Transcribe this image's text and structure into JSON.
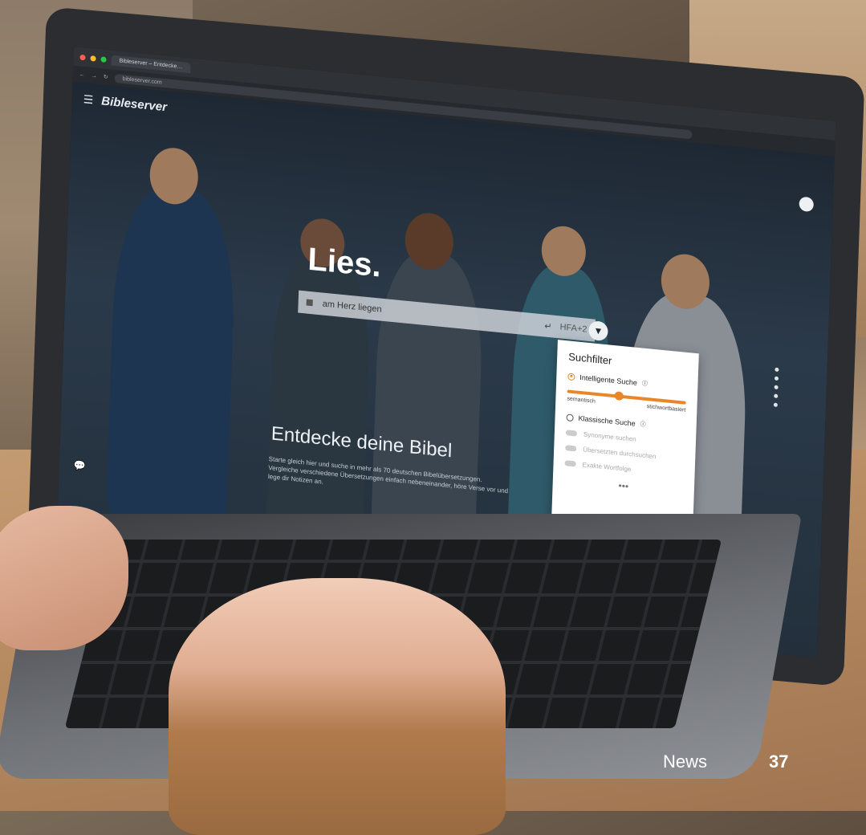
{
  "browser": {
    "tab_title": "Bibleserver – Entdecke…",
    "url": "bibleserver.com"
  },
  "site": {
    "logo": "Bibleserver",
    "headline": "Lies.",
    "search": {
      "value": "am Herz liegen",
      "translation": "HFA+2"
    },
    "tagline": "Entdecke deine Bibel",
    "intro": "Starte gleich hier und suche in mehr als 70 deutschen Bibelübersetzungen. Vergleiche verschiedene Übersetzungen einfach nebeneinander, höre Verse vor und lege dir Notizen an."
  },
  "filter_panel": {
    "title": "Suchfilter",
    "smart_search_label": "Intelligente Suche",
    "slider_left": "semantisch",
    "slider_right": "stichwortbasiert",
    "slider_value": 0.4,
    "classic_search_label": "Klassische Suche",
    "toggles": [
      "Synonyme suchen",
      "Übersetzten durchsuchen",
      "Exakte Wortfolge"
    ],
    "more": "•••"
  },
  "footer": {
    "section": "News",
    "page": "37"
  },
  "icons": {
    "menu": "menu-icon",
    "account": "account-icon",
    "filter": "filter-icon",
    "chat": "chat-icon",
    "search": "book-icon"
  },
  "colors": {
    "accent": "#e8862a"
  }
}
